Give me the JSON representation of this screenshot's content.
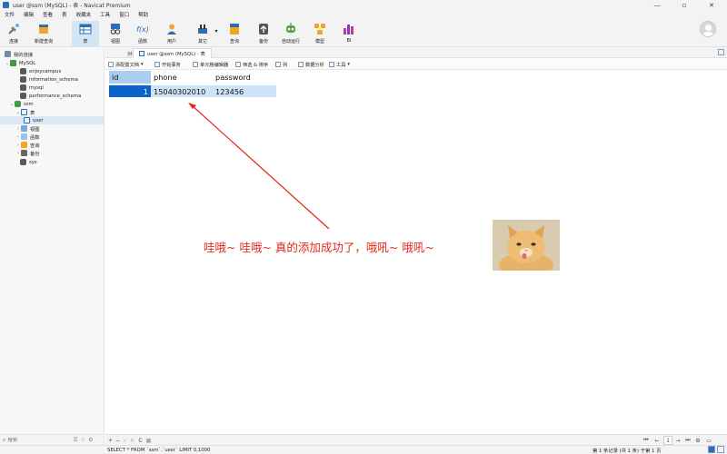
{
  "window": {
    "title": "user @ssm (MySQL) - 表 - Navicat Premium"
  },
  "menu": [
    "文件",
    "编辑",
    "查看",
    "表",
    "收藏夹",
    "工具",
    "窗口",
    "帮助"
  ],
  "toolbar": {
    "connect": "连接",
    "new_query": "新建查询",
    "table": "表",
    "view": "视图",
    "function": "函数",
    "user": "用户",
    "other": "其它",
    "query": "查询",
    "backup": "备份",
    "auto_run": "自动运行",
    "model": "模型",
    "bi": "BI",
    "fx_glyph": "f(x)"
  },
  "sidebar": {
    "header": "我的连接",
    "connection": "MySQL",
    "databases": [
      "enjoycampus",
      "information_schema",
      "mysql",
      "performance_schema",
      "ssm"
    ],
    "ssm_children": {
      "tables": "表",
      "user": "user",
      "views": "视图",
      "functions": "函数",
      "queries": "查询",
      "backups": "备份"
    },
    "sys": "sys",
    "search_placeholder": "搜索"
  },
  "tabs": {
    "objects": "对象",
    "current": "user @ssm (MySQL) - 表"
  },
  "subtoolbar": {
    "config_wizard": "添配置文档",
    "begin_tx": "开始事务",
    "cell_editor": "单元格编辑器",
    "filter_sort": "筛选 & 排序",
    "columns": "列",
    "data_analysis": "数据分析",
    "tools": "工具"
  },
  "grid": {
    "columns": [
      "id",
      "phone",
      "password"
    ],
    "rows": [
      [
        "1",
        "15040302010",
        "123456"
      ]
    ]
  },
  "annotation": {
    "caption": "哇哦~ 哇哦~ 真的添加成功了，哦吼~ 哦吼~",
    "arrow_color": "#e3261c"
  },
  "navbar": {
    "add": "+",
    "remove": "−",
    "apply": "✓",
    "discard": "✕",
    "refresh": "C",
    "stop": "■",
    "page": "1"
  },
  "status": {
    "sql": "SELECT * FROM `ssm`.`user` LIMIT 0,1000",
    "records": "第 1 条记录 (共 1 条) 于第 1 页"
  },
  "colors": {
    "accent": "#2d6db5",
    "selection": "#0a64c8",
    "row_highlight": "#cfe3f6"
  }
}
